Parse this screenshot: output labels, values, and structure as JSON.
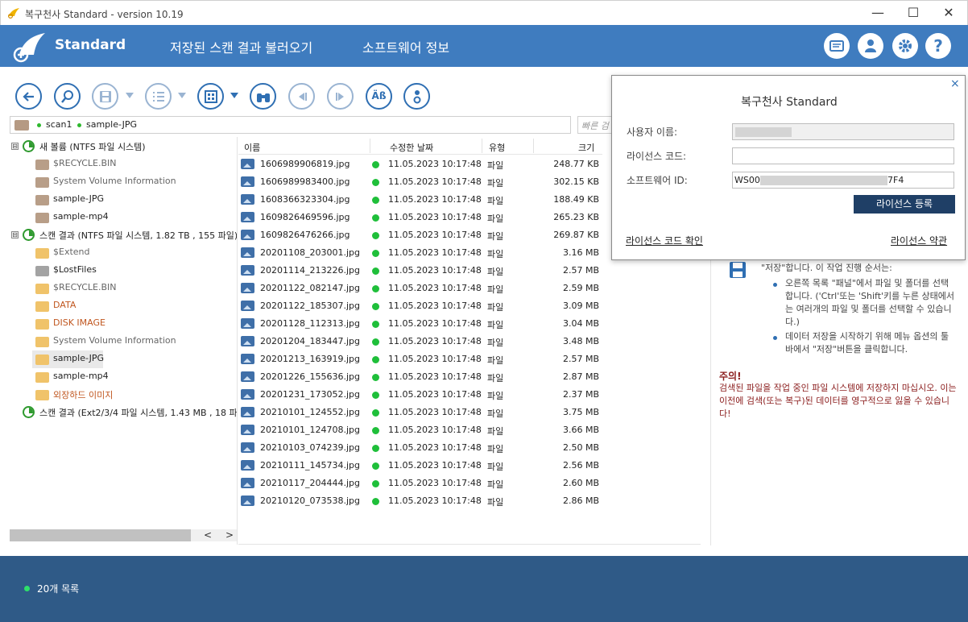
{
  "window": {
    "title": "복구천사 Standard - version 10.19",
    "minimize": "—",
    "maximize": "☐",
    "close": "✕"
  },
  "header": {
    "brand": "Standard",
    "menu": [
      "저장된 스캔 결과 불러오기",
      "소프트웨어 정보"
    ]
  },
  "path": {
    "crumbs": [
      "scan1",
      "sample-JPG"
    ],
    "search_placeholder": "빠른 검"
  },
  "tree": [
    {
      "label": "새 볼륨 (NTFS 파일 시스템)",
      "type": "disk",
      "expander": "⊟"
    },
    {
      "label": "$RECYCLE.BIN",
      "type": "folder-brown",
      "style": "gray"
    },
    {
      "label": "System Volume Information",
      "type": "folder-brown",
      "style": "gray"
    },
    {
      "label": "sample-JPG",
      "type": "folder-brown",
      "style": "dark"
    },
    {
      "label": "sample-mp4",
      "type": "folder-brown",
      "style": "dark"
    },
    {
      "label": "스캔 결과 (NTFS 파일 시스템, 1.82 TB , 155 파일)",
      "type": "disk",
      "expander": "⊟"
    },
    {
      "label": "$Extend",
      "type": "folder-yellow",
      "style": "gray"
    },
    {
      "label": "$LostFiles",
      "type": "folder-gray",
      "style": "dark"
    },
    {
      "label": "$RECYCLE.BIN",
      "type": "folder-yellow",
      "style": "gray"
    },
    {
      "label": "DATA",
      "type": "folder-yellow",
      "style": "orange"
    },
    {
      "label": "DISK IMAGE",
      "type": "folder-yellow",
      "style": "orange"
    },
    {
      "label": "System Volume Information",
      "type": "folder-yellow",
      "style": "gray"
    },
    {
      "label": "sample-JPG",
      "type": "folder-yellow",
      "style": "dark",
      "selected": true
    },
    {
      "label": "sample-mp4",
      "type": "folder-yellow",
      "style": "dark"
    },
    {
      "label": "외장하드 이미지",
      "type": "folder-yellow",
      "style": "orange"
    },
    {
      "label": "스캔 결과 (Ext2/3/4 파일 시스템, 1.43 MB , 18 파",
      "type": "disk",
      "expander": ""
    }
  ],
  "filelist": {
    "columns": [
      "이름",
      "수정한 날짜",
      "유형",
      "크기"
    ],
    "rows": [
      [
        "1606989906819.jpg",
        "11.05.2023 10:17:48",
        "파일",
        "248.77 KB"
      ],
      [
        "1606989983400.jpg",
        "11.05.2023 10:17:48",
        "파일",
        "302.15 KB"
      ],
      [
        "1608366323304.jpg",
        "11.05.2023 10:17:48",
        "파일",
        "188.49 KB"
      ],
      [
        "1609826469596.jpg",
        "11.05.2023 10:17:48",
        "파일",
        "265.23 KB"
      ],
      [
        "1609826476266.jpg",
        "11.05.2023 10:17:48",
        "파일",
        "269.87 KB"
      ],
      [
        "20201108_203001.jpg",
        "11.05.2023 10:17:48",
        "파일",
        "3.16 MB"
      ],
      [
        "20201114_213226.jpg",
        "11.05.2023 10:17:48",
        "파일",
        "2.57 MB"
      ],
      [
        "20201122_082147.jpg",
        "11.05.2023 10:17:48",
        "파일",
        "2.59 MB"
      ],
      [
        "20201122_185307.jpg",
        "11.05.2023 10:17:48",
        "파일",
        "3.09 MB"
      ],
      [
        "20201128_112313.jpg",
        "11.05.2023 10:17:48",
        "파일",
        "3.04 MB"
      ],
      [
        "20201204_183447.jpg",
        "11.05.2023 10:17:48",
        "파일",
        "3.48 MB"
      ],
      [
        "20201213_163919.jpg",
        "11.05.2023 10:17:48",
        "파일",
        "2.57 MB"
      ],
      [
        "20201226_155636.jpg",
        "11.05.2023 10:17:48",
        "파일",
        "2.87 MB"
      ],
      [
        "20201231_173052.jpg",
        "11.05.2023 10:17:48",
        "파일",
        "2.37 MB"
      ],
      [
        "20210101_124552.jpg",
        "11.05.2023 10:17:48",
        "파일",
        "3.75 MB"
      ],
      [
        "20210101_124708.jpg",
        "11.05.2023 10:17:48",
        "파일",
        "3.66 MB"
      ],
      [
        "20210103_074239.jpg",
        "11.05.2023 10:17:48",
        "파일",
        "2.50 MB"
      ],
      [
        "20210111_145734.jpg",
        "11.05.2023 10:17:48",
        "파일",
        "2.56 MB"
      ],
      [
        "20210117_204444.jpg",
        "11.05.2023 10:17:48",
        "파일",
        "2.60 MB"
      ],
      [
        "20210120_073538.jpg",
        "11.05.2023 10:17:48",
        "파일",
        "2.86 MB"
      ]
    ]
  },
  "info": {
    "save_line": "\"저장\"합니다. 이 작업 진행 순서는:",
    "bullet1": "오른쪽 목록 \"패널\"에서 파일 및 폴더를 선택합니다. ('Ctrl'또는 'Shift'키를 누른 상태에서는 여러개의 파일 및 폴더를 선택할 수 있습니다.)",
    "bullet2": "데이터 저장을 시작하기 위해 메뉴 옵션의 툴바에서 \"저장\"버튼을 클릭합니다.",
    "warn_title": "주의!",
    "warn_text": "검색된 파일을 작업 중인 파일 시스템에 저장하지 마십시오. 이는 이전에 검색(또는 복구)된 데이터를 영구적으로 잃을 수 있습니다!"
  },
  "popup": {
    "title": "복구천사 Standard",
    "close": "×",
    "username_label": "사용자 이름:",
    "license_label": "라이선스 코드:",
    "softid_label": "소프트웨어 ID:",
    "softid_prefix": "WS00",
    "softid_suffix": "7F4",
    "register_button": "라이선스 등록",
    "check_link": "라이선스 코드 확인",
    "terms_link": "라이선스 약관"
  },
  "status": {
    "text": "20개 목록"
  },
  "scroll": {
    "left": "<",
    "right": ">"
  }
}
